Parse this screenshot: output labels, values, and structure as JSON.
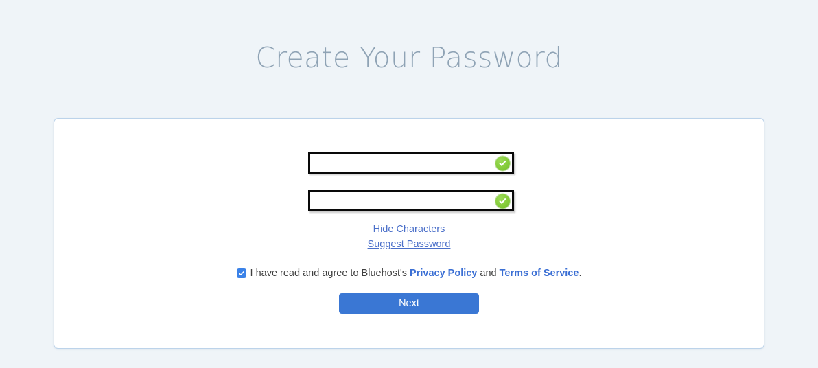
{
  "page": {
    "title": "Create Your Password",
    "background_color": "#eff4f8",
    "title_color": "#8fa3b5"
  },
  "card": {
    "border_color": "#bcd3ea",
    "background_color": "#ffffff"
  },
  "form": {
    "fields": [
      {
        "name": "password",
        "value": "",
        "placeholder": "",
        "valid": true,
        "validation_icon": "green-check-circle-icon"
      },
      {
        "name": "confirm-password",
        "value": "",
        "placeholder": "",
        "valid": true,
        "validation_icon": "green-check-circle-icon"
      }
    ],
    "helper_links": [
      {
        "label": "Hide Characters",
        "color": "#4a6fc9"
      },
      {
        "label": "Suggest Password",
        "color": "#4a6fc9"
      }
    ],
    "agreement": {
      "checked": true,
      "checkbox_color": "#3b82e8",
      "text_before": "I have read and agree to Bluehost's",
      "privacy_link": "Privacy Policy",
      "text_between": "and",
      "terms_link": "Terms of Service",
      "text_after": ".",
      "link_color": "#3b6fd4"
    },
    "submit": {
      "label": "Next",
      "background_color": "#3a77d4",
      "text_color": "#ffffff"
    }
  }
}
